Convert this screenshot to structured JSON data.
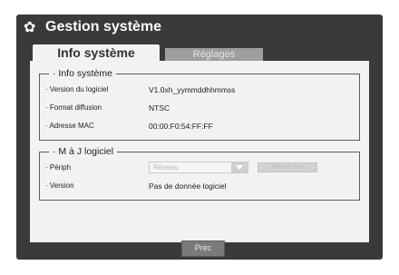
{
  "window": {
    "title": "Gestion système",
    "title_icon": "gear-icon"
  },
  "tabs": [
    {
      "label": "Info système",
      "active": true
    },
    {
      "label": "Réglages",
      "active": false
    }
  ],
  "info_group": {
    "label": "· Info système",
    "rows": [
      {
        "label": "· Version du logiciel",
        "value": "V1.0xh_yymmddhhmmss"
      },
      {
        "label": "· Format diffusion",
        "value": "NTSC"
      },
      {
        "label": "· Adresse MAC",
        "value": "00:00:F0:54:FF:FF"
      }
    ]
  },
  "update_group": {
    "label": "· M à J logiciel",
    "device_label": "· Périph",
    "device_select_value": "Réseau",
    "update_button_label": "Mise à jour",
    "version_label": "· Version",
    "version_value": "Pas de donnée logiciel"
  },
  "footer": {
    "prev_label": "Préc"
  }
}
